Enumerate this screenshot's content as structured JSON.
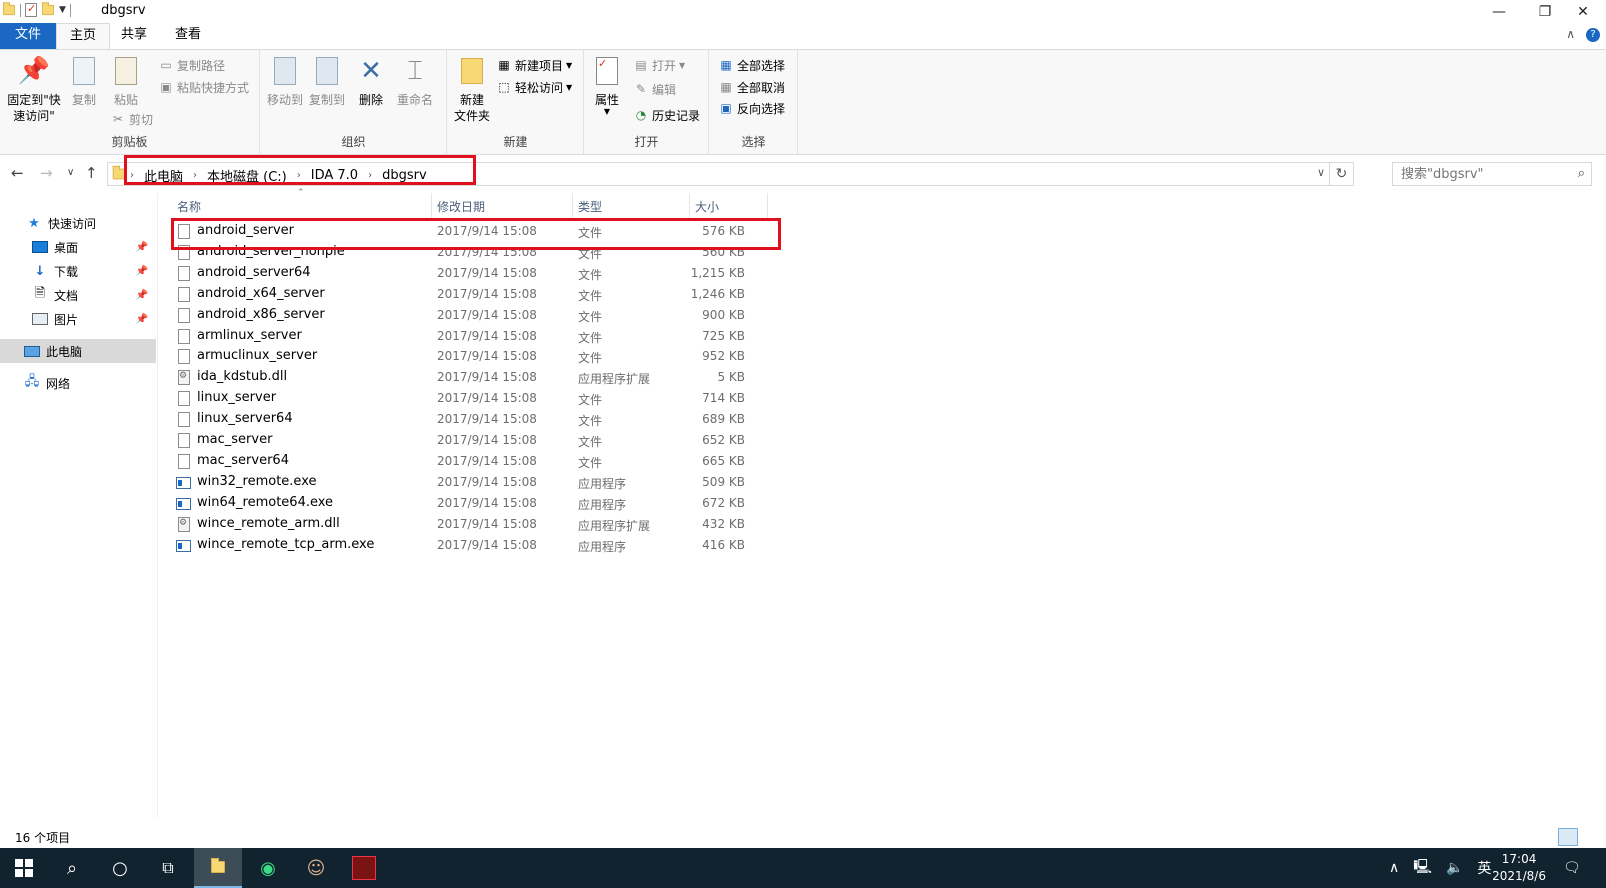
{
  "window": {
    "title": "dbgsrv",
    "controls": {
      "minimize": "—",
      "restore": "❐",
      "close": "✕"
    }
  },
  "ribbon_tabs": [
    "文件",
    "主页",
    "共享",
    "查看"
  ],
  "ribbon": {
    "clipboard": {
      "label": "剪贴板",
      "pin": "固定到\"快\n速访问\"",
      "copy": "复制",
      "paste": "粘贴",
      "copy_path": "复制路径",
      "paste_shortcut": "粘贴快捷方式",
      "cut": "剪切"
    },
    "organize": {
      "label": "组织",
      "move_to": "移动到",
      "copy_to": "复制到",
      "delete": "删除",
      "rename": "重命名"
    },
    "new": {
      "label": "新建",
      "new_folder": "新建\n文件夹",
      "new_item": "新建项目",
      "easy_access": "轻松访问"
    },
    "open": {
      "label": "打开",
      "properties": "属性",
      "open": "打开",
      "edit": "编辑",
      "history": "历史记录"
    },
    "select": {
      "label": "选择",
      "select_all": "全部选择",
      "select_none": "全部取消",
      "invert": "反向选择"
    }
  },
  "address": {
    "crumbs": [
      "此电脑",
      "本地磁盘 (C:)",
      "IDA 7.0",
      "dbgsrv"
    ],
    "search_placeholder": "搜索\"dbgsrv\""
  },
  "nav": {
    "quick_access": "快速访问",
    "items": [
      "桌面",
      "下载",
      "文档",
      "图片"
    ],
    "this_pc": "此电脑",
    "network": "网络"
  },
  "columns": {
    "name": "名称",
    "date": "修改日期",
    "type": "类型",
    "size": "大小"
  },
  "files": [
    {
      "name": "android_server",
      "date": "2017/9/14 15:08",
      "type": "文件",
      "size": "576 KB",
      "kind": "file"
    },
    {
      "name": "android_server_nonpie",
      "date": "2017/9/14 15:08",
      "type": "文件",
      "size": "560 KB",
      "kind": "file"
    },
    {
      "name": "android_server64",
      "date": "2017/9/14 15:08",
      "type": "文件",
      "size": "1,215 KB",
      "kind": "file"
    },
    {
      "name": "android_x64_server",
      "date": "2017/9/14 15:08",
      "type": "文件",
      "size": "1,246 KB",
      "kind": "file"
    },
    {
      "name": "android_x86_server",
      "date": "2017/9/14 15:08",
      "type": "文件",
      "size": "900 KB",
      "kind": "file"
    },
    {
      "name": "armlinux_server",
      "date": "2017/9/14 15:08",
      "type": "文件",
      "size": "725 KB",
      "kind": "file"
    },
    {
      "name": "armuclinux_server",
      "date": "2017/9/14 15:08",
      "type": "文件",
      "size": "952 KB",
      "kind": "file"
    },
    {
      "name": "ida_kdstub.dll",
      "date": "2017/9/14 15:08",
      "type": "应用程序扩展",
      "size": "5 KB",
      "kind": "dll"
    },
    {
      "name": "linux_server",
      "date": "2017/9/14 15:08",
      "type": "文件",
      "size": "714 KB",
      "kind": "file"
    },
    {
      "name": "linux_server64",
      "date": "2017/9/14 15:08",
      "type": "文件",
      "size": "689 KB",
      "kind": "file"
    },
    {
      "name": "mac_server",
      "date": "2017/9/14 15:08",
      "type": "文件",
      "size": "652 KB",
      "kind": "file"
    },
    {
      "name": "mac_server64",
      "date": "2017/9/14 15:08",
      "type": "文件",
      "size": "665 KB",
      "kind": "file"
    },
    {
      "name": "win32_remote.exe",
      "date": "2017/9/14 15:08",
      "type": "应用程序",
      "size": "509 KB",
      "kind": "exe"
    },
    {
      "name": "win64_remote64.exe",
      "date": "2017/9/14 15:08",
      "type": "应用程序",
      "size": "672 KB",
      "kind": "exe"
    },
    {
      "name": "wince_remote_arm.dll",
      "date": "2017/9/14 15:08",
      "type": "应用程序扩展",
      "size": "432 KB",
      "kind": "dll"
    },
    {
      "name": "wince_remote_tcp_arm.exe",
      "date": "2017/9/14 15:08",
      "type": "应用程序",
      "size": "416 KB",
      "kind": "exe"
    }
  ],
  "status": {
    "count": "16 个项目"
  },
  "taskbar": {
    "time": "17:04",
    "date": "2021/8/6",
    "ime": "英",
    "tray_up": "∧"
  },
  "colors": {
    "file_tab": "#1a68c2",
    "highlight": "#e0101f",
    "taskbar": "#10232f"
  }
}
